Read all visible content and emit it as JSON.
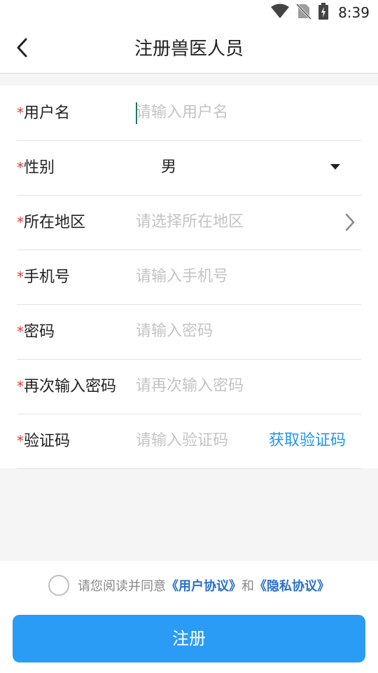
{
  "status_bar": {
    "time": "8:39",
    "icons": [
      "wifi-icon",
      "no-sim-icon",
      "battery-charging-icon"
    ]
  },
  "header": {
    "title": "注册兽医人员",
    "back_icon": "back-chevron-icon"
  },
  "form": {
    "required_mark": "*",
    "fields": [
      {
        "label": "用户名",
        "placeholder": "请输入用户名",
        "value": ""
      },
      {
        "label": "性别",
        "value": "男"
      },
      {
        "label": "所在地区",
        "placeholder": "请选择所在地区"
      },
      {
        "label": "手机号",
        "placeholder": "请输入手机号",
        "value": ""
      },
      {
        "label": "密码",
        "placeholder": "请输入密码",
        "value": ""
      },
      {
        "label": "再次输入密码",
        "placeholder": "请再次输入密码",
        "value": ""
      },
      {
        "label": "验证码",
        "placeholder": "请输入验证码",
        "value": "",
        "action_label": "获取验证码"
      }
    ]
  },
  "agreement": {
    "prefix": "请您阅读并同意",
    "user_agreement": "《用户协议》",
    "conjunction": "和",
    "privacy_agreement": "《隐私协议》",
    "checked": false
  },
  "register_button": {
    "label": "注册"
  },
  "colors": {
    "accent": "#2b9cf5",
    "link": "#2b70c9",
    "required": "#e53935",
    "placeholder": "#c4c4c4"
  }
}
